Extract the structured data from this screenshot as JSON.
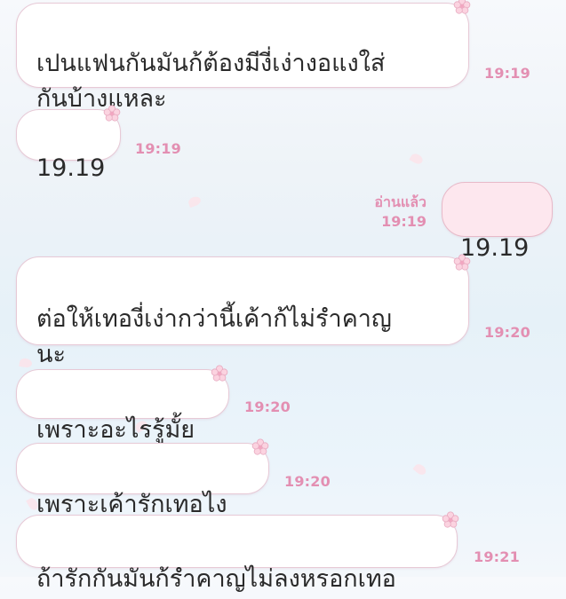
{
  "messages": [
    {
      "text": "เปนแฟนกันมันก้ต้องมีงี่เง่างอแงใส่\nกันบ้างแหละ",
      "time": "19:19",
      "side": "left"
    },
    {
      "text": "19.19",
      "time": "19:19",
      "side": "left"
    },
    {
      "text": "19.19",
      "time": "19:19",
      "side": "right",
      "read": "อ่านแล้ว"
    },
    {
      "text": "ต่อให้เทองี่เง่ากว่านี้เค้าก้ไม่รำคาญ\nนะ",
      "time": "19:20",
      "side": "left"
    },
    {
      "text": "เพราะอะไรรู้มั้ย",
      "time": "19:20",
      "side": "left"
    },
    {
      "text": "เพราะเค้ารักเทอไง",
      "time": "19:20",
      "side": "left"
    },
    {
      "text": "ถ้ารักกันมันก้รำคาญไม่ลงหรอกเทอ",
      "time": "19:21",
      "side": "left"
    }
  ],
  "colors": {
    "accent": "#e38fb2",
    "bubble_border": "#e7c9d6",
    "my_bubble": "#fde7ee"
  },
  "icons": {
    "sticker": "cherry-blossom-icon"
  }
}
